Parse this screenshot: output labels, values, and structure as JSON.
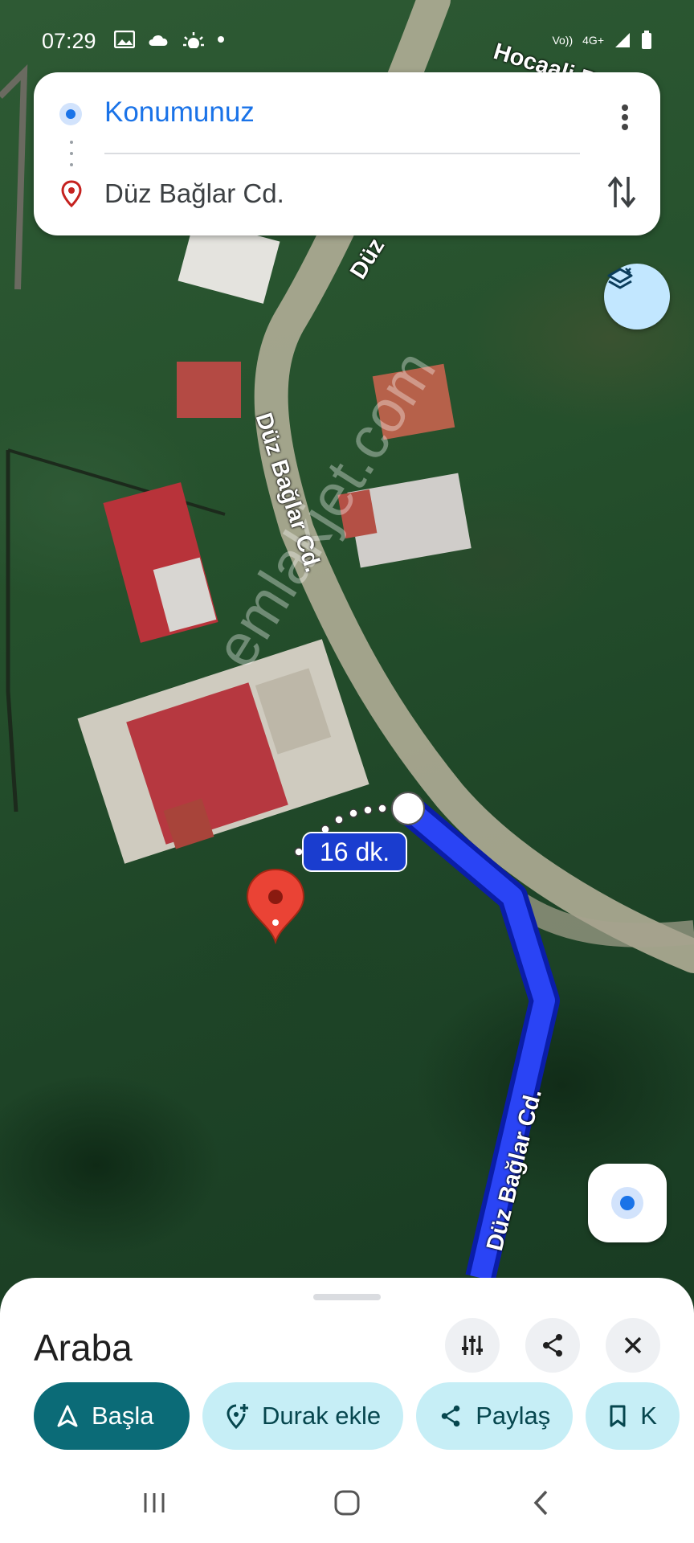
{
  "status_bar": {
    "time": "07:29",
    "network": "4G+",
    "carrier": "Vo))"
  },
  "route": {
    "origin": "Konumunuz",
    "destination": "Düz Bağlar Cd."
  },
  "map": {
    "road_labels": [
      "Hocaali Bağlar",
      "Düz",
      "Düz Bağlar Cd.",
      "Düz Bağlar Cd."
    ],
    "eta": "16 dk.",
    "route_color": "#1a3dcf",
    "watermark": "emlakjet.com"
  },
  "sheet": {
    "mode_title": "Araba",
    "actions": [
      {
        "label": "Başla",
        "icon": "navigation-arrow-icon"
      },
      {
        "label": "Durak ekle",
        "icon": "add-stop-icon"
      },
      {
        "label": "Paylaş",
        "icon": "share-icon"
      },
      {
        "label": "K",
        "icon": "bookmark-icon"
      }
    ]
  },
  "colors": {
    "accent": "#1a73e8",
    "primary_chip": "#0b6b77",
    "light_chip": "#c6eef6"
  }
}
